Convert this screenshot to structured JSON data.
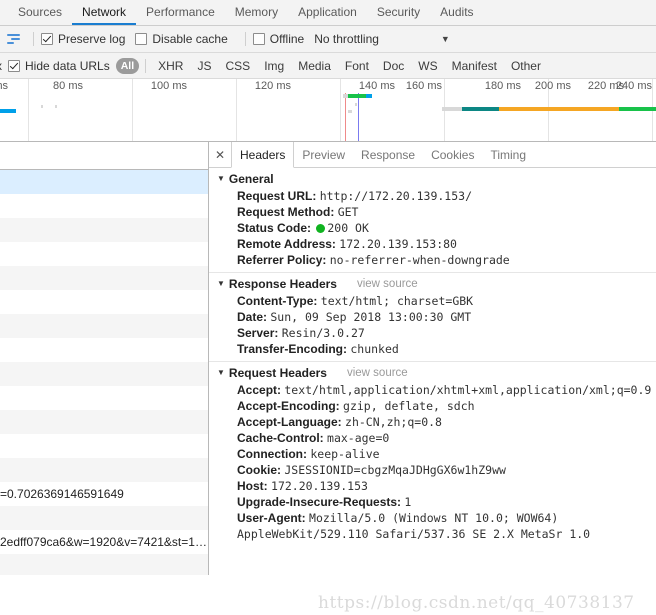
{
  "devtools_tabs": [
    {
      "label": "Sources",
      "active": false
    },
    {
      "label": "Network",
      "active": true
    },
    {
      "label": "Performance",
      "active": false
    },
    {
      "label": "Memory",
      "active": false
    },
    {
      "label": "Application",
      "active": false
    },
    {
      "label": "Security",
      "active": false
    },
    {
      "label": "Audits",
      "active": false
    }
  ],
  "toolbar": {
    "record_icon": "record-network-log-icon",
    "preserve_log_label": "Preserve log",
    "preserve_log_checked": true,
    "disable_cache_label": "Disable cache",
    "disable_cache_checked": false,
    "offline_label": "Offline",
    "offline_checked": false,
    "throttling_value": "No throttling",
    "throttling_caret": "▼"
  },
  "filter_bar": {
    "regex_label_clipped": "x",
    "hide_data_urls_label": "Hide data URLs",
    "hide_data_urls_checked": true,
    "types": [
      {
        "label": "All",
        "active": true
      },
      {
        "label": "XHR",
        "active": false
      },
      {
        "label": "JS",
        "active": false
      },
      {
        "label": "CSS",
        "active": false
      },
      {
        "label": "Img",
        "active": false
      },
      {
        "label": "Media",
        "active": false
      },
      {
        "label": "Font",
        "active": false
      },
      {
        "label": "Doc",
        "active": false
      },
      {
        "label": "WS",
        "active": false
      },
      {
        "label": "Manifest",
        "active": false
      },
      {
        "label": "Other",
        "active": false
      }
    ]
  },
  "overview": {
    "tick_labels": [
      "ms",
      "80 ms",
      "100 ms",
      "120 ms",
      "140 ms",
      "160 ms",
      "180 ms",
      "200 ms",
      "220 ms",
      "240 ms"
    ],
    "tick_x": [
      12,
      87,
      191,
      295,
      399,
      503,
      504,
      607,
      656,
      656
    ],
    "colors": {
      "blue": "#00a0e9",
      "grey": "#c9c9c9",
      "teal": "#0c8784",
      "orange": "#f5a623",
      "green": "#18c24a",
      "dom_content_loaded": "#ef8a8a",
      "load_event": "#7b7bf0"
    }
  },
  "request_list": {
    "rows": [
      {
        "text": "",
        "style": "sel"
      },
      {
        "text": "",
        "style": "even"
      },
      {
        "text": "",
        "style": "odd"
      },
      {
        "text": "",
        "style": "even"
      },
      {
        "text": "",
        "style": "odd"
      },
      {
        "text": "",
        "style": "even"
      },
      {
        "text": "",
        "style": "odd"
      },
      {
        "text": "",
        "style": "even"
      },
      {
        "text": "",
        "style": "odd"
      },
      {
        "text": "",
        "style": "even"
      },
      {
        "text": "",
        "style": "odd"
      },
      {
        "text": "",
        "style": "even"
      },
      {
        "text": "",
        "style": "odd"
      },
      {
        "text": "=0.7026369146591649",
        "style": "even"
      },
      {
        "text": "",
        "style": "odd"
      },
      {
        "text": "2edff079ca6&w=1920&v=7421&st=1…",
        "style": "even"
      },
      {
        "text": "",
        "style": "odd"
      },
      {
        "text": "",
        "style": "even"
      }
    ]
  },
  "detail": {
    "close_icon": "close-icon",
    "tabs": [
      {
        "label": "Headers",
        "active": true
      },
      {
        "label": "Preview",
        "active": false
      },
      {
        "label": "Response",
        "active": false
      },
      {
        "label": "Cookies",
        "active": false
      },
      {
        "label": "Timing",
        "active": false
      }
    ],
    "sections": [
      {
        "title": "General",
        "triangle": "▼",
        "view_source": "",
        "rows": [
          {
            "key": "Request URL:",
            "value": "http://172.20.139.153/",
            "status": false
          },
          {
            "key": "Request Method:",
            "value": "GET",
            "status": false
          },
          {
            "key": "Status Code:",
            "value": "200 OK",
            "status": true
          },
          {
            "key": "Remote Address:",
            "value": "172.20.139.153:80",
            "status": false
          },
          {
            "key": "Referrer Policy:",
            "value": "no-referrer-when-downgrade",
            "status": false
          }
        ]
      },
      {
        "title": "Response Headers",
        "triangle": "▼",
        "view_source": "view source",
        "rows": [
          {
            "key": "Content-Type:",
            "value": "text/html; charset=GBK",
            "status": false
          },
          {
            "key": "Date:",
            "value": "Sun, 09 Sep 2018 13:00:30 GMT",
            "status": false
          },
          {
            "key": "Server:",
            "value": "Resin/3.0.27",
            "status": false
          },
          {
            "key": "Transfer-Encoding:",
            "value": "chunked",
            "status": false
          }
        ]
      },
      {
        "title": "Request Headers",
        "triangle": "▼",
        "view_source": "view source",
        "rows": [
          {
            "key": "Accept:",
            "value": "text/html,application/xhtml+xml,application/xml;q=0.9",
            "status": false
          },
          {
            "key": "Accept-Encoding:",
            "value": "gzip, deflate, sdch",
            "status": false
          },
          {
            "key": "Accept-Language:",
            "value": "zh-CN,zh;q=0.8",
            "status": false
          },
          {
            "key": "Cache-Control:",
            "value": "max-age=0",
            "status": false
          },
          {
            "key": "Connection:",
            "value": "keep-alive",
            "status": false
          },
          {
            "key": "Cookie:",
            "value": "JSESSIONID=cbgzMqaJDHgGX6w1hZ9ww",
            "status": false
          },
          {
            "key": "Host:",
            "value": "172.20.139.153",
            "status": false
          },
          {
            "key": "Upgrade-Insecure-Requests:",
            "value": "1",
            "status": false
          },
          {
            "key": "User-Agent:",
            "value": "Mozilla/5.0 (Windows NT 10.0; WOW64) AppleWebKit/529.110 Safari/537.36 SE 2.X MetaSr 1.0",
            "status": false
          }
        ]
      }
    ]
  },
  "watermark": "https://blog.csdn.net/qq_40738137"
}
